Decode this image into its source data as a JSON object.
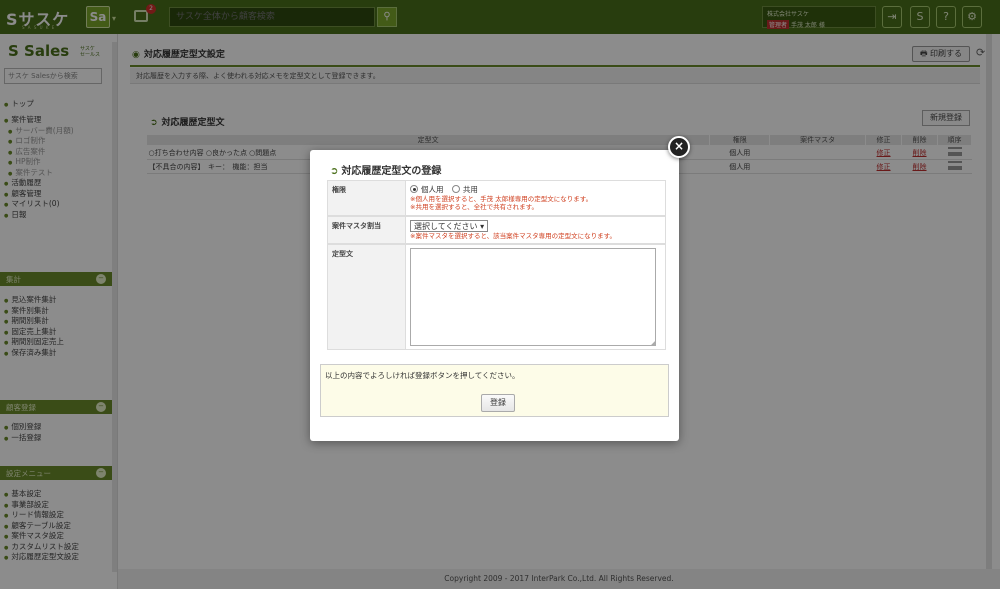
{
  "topbar": {
    "logo": "Sサスケ",
    "logo_sub": "S A S U K E",
    "app_badge": "Sa",
    "app_caret": "▾",
    "notification_count": "2",
    "search_placeholder": "サスケ全体から顧客検索",
    "company": "株式会社サスケ",
    "user_tag": "管理者",
    "user_name": "手茂 太郎 様"
  },
  "sidebar": {
    "logo": "S Sales",
    "logo_sub_1": "サスケ",
    "logo_sub_2": "セールス",
    "search_placeholder": "サスケ Salesから検索",
    "group1": [
      "トップ"
    ],
    "group2": [
      {
        "label": "案件管理",
        "sub": false
      },
      {
        "label": "サーバー費(月額)",
        "sub": true
      },
      {
        "label": "ロゴ制作",
        "sub": true
      },
      {
        "label": "広告案件",
        "sub": true
      },
      {
        "label": "HP制作",
        "sub": true
      },
      {
        "label": "案件テスト",
        "sub": true
      },
      {
        "label": "活動履歴",
        "sub": false
      },
      {
        "label": "顧客管理",
        "sub": false
      },
      {
        "label": "マイリスト(0)",
        "sub": false
      },
      {
        "label": "日報",
        "sub": false
      }
    ],
    "head_stats": "集計",
    "stats": [
      "見込案件集計",
      "案件別集計",
      "期間別集計",
      "固定売上集計",
      "期間別固定売上",
      "保存済み集計"
    ],
    "head_bulk": "顧客登録",
    "bulk": [
      "個別登録",
      "一括登録"
    ],
    "head_settings": "設定メニュー",
    "settings": [
      "基本設定",
      "事業部設定",
      "リード情報設定",
      "顧客テーブル設定",
      "案件マスタ設定",
      "カスタムリスト設定",
      "対応履歴定型文設定"
    ]
  },
  "main": {
    "page_title": "対応履歴定型文設定",
    "print_label": "印刷する",
    "description": "対応履歴を入力する際、よく使われる対応メモを定型文として登録できます。",
    "section_title": "対応履歴定型文",
    "new_button": "新規登録",
    "columns": [
      "定型文",
      "権限",
      "案件マスタ",
      "修正",
      "削除",
      "順序"
    ],
    "rows": [
      {
        "text": "○打ち合わせ内容 ○良かった点 ○問題点",
        "scope": "個人用",
        "master": "",
        "edit": "修正",
        "delete": "削除"
      },
      {
        "text": "【不具合の内容】　キー：　機能：担当",
        "scope": "個人用",
        "master": "",
        "edit": "修正",
        "delete": "削除"
      }
    ]
  },
  "footer": "Copyright 2009 - 2017 InterPark Co.,Ltd. All Rights Reserved.",
  "modal": {
    "title": "対応履歴定型文の登録",
    "close": "×",
    "perm_label": "権限",
    "opt_personal": "個人用",
    "opt_shared": "共用",
    "perm_note1": "※個人用を選択すると、手茂 太郎様専用の定型文になります。",
    "perm_note2": "※共用を選択すると、全社で共有されます。",
    "master_label": "案件マスタ割当",
    "master_select": "選択してください",
    "master_note": "※案件マスタを選択すると、該当案件マスタ専用の定型文になります。",
    "text_label": "定型文",
    "confirm_text": "以上の内容でよろしければ登録ボタンを押してください。",
    "register_label": "登録"
  },
  "colors": {
    "brand": "#4a6f1a",
    "accent": "#6a8a2a",
    "note": "#d04020"
  }
}
